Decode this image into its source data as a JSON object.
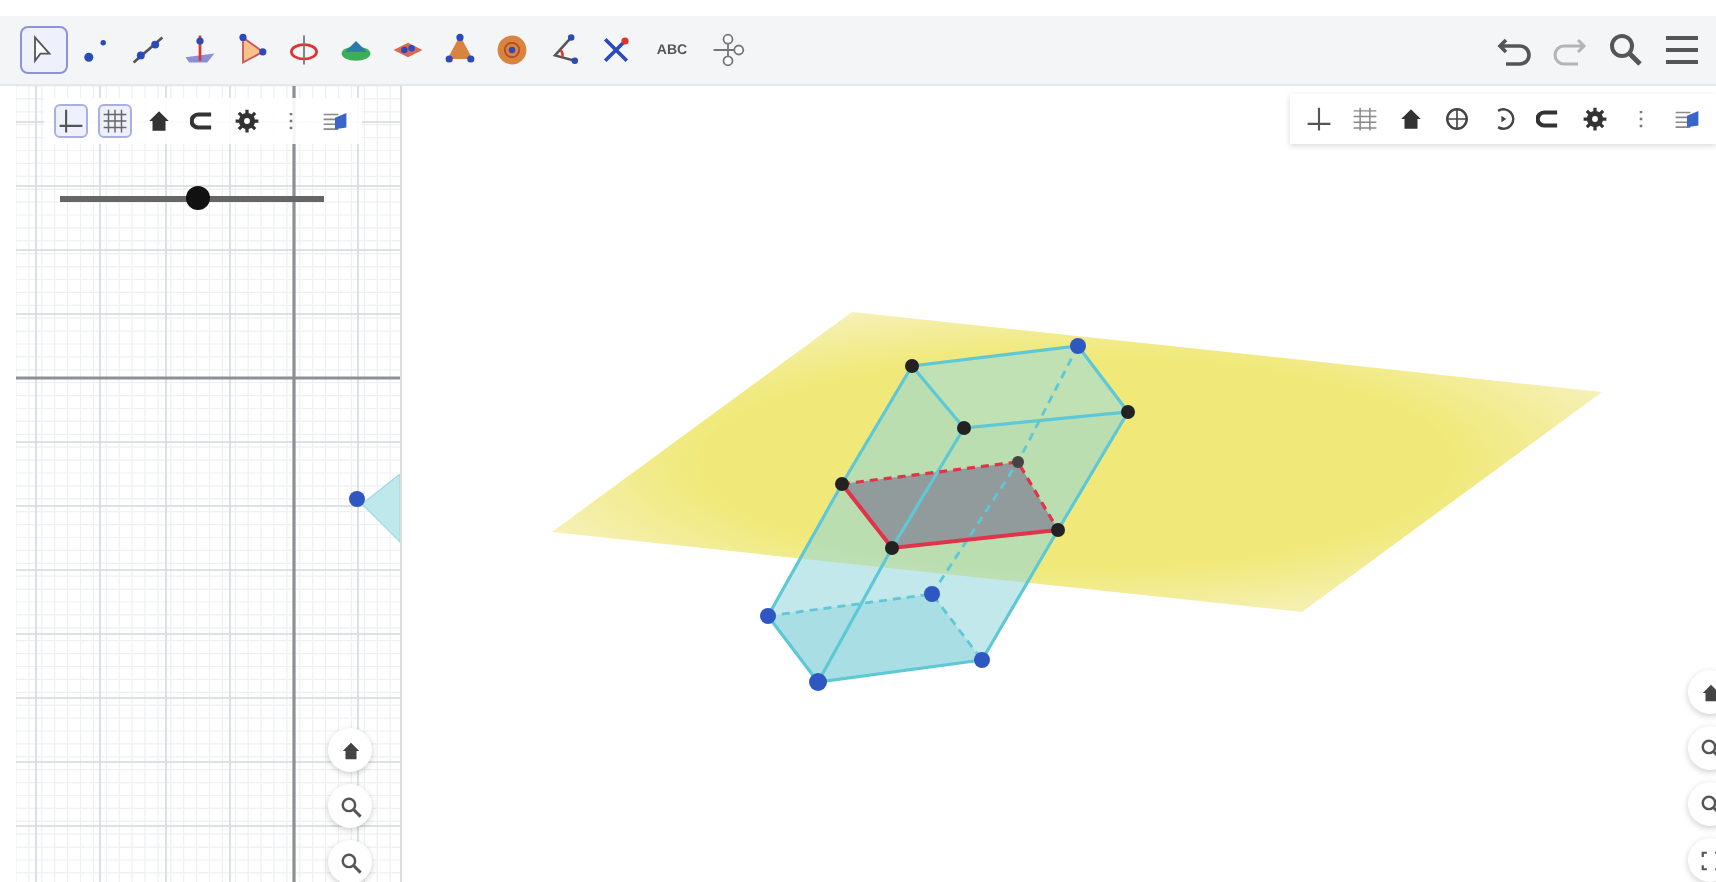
{
  "toolbar": {
    "tools": [
      {
        "kind": "move",
        "selected": true
      },
      {
        "kind": "point",
        "selected": false
      },
      {
        "kind": "line",
        "selected": false
      },
      {
        "kind": "perpendicular",
        "selected": false
      },
      {
        "kind": "polygon",
        "selected": false
      },
      {
        "kind": "circle",
        "selected": false
      },
      {
        "kind": "solid",
        "selected": false
      },
      {
        "kind": "plane",
        "selected": false
      },
      {
        "kind": "pyramid",
        "selected": false
      },
      {
        "kind": "sphere",
        "selected": false
      },
      {
        "kind": "angle",
        "selected": false
      },
      {
        "kind": "reflect",
        "selected": false
      },
      {
        "kind": "text",
        "label": "ABC",
        "selected": false
      },
      {
        "kind": "transform",
        "selected": false
      }
    ],
    "actions": [
      {
        "kind": "undo",
        "disabled": false
      },
      {
        "kind": "redo",
        "disabled": true
      },
      {
        "kind": "search",
        "disabled": false
      },
      {
        "kind": "menu",
        "disabled": false
      }
    ]
  },
  "graphics": {
    "style_bar": [
      {
        "kind": "axes",
        "on": true
      },
      {
        "kind": "grid",
        "on": true
      },
      {
        "kind": "home",
        "on": false
      },
      {
        "kind": "copy",
        "on": false
      },
      {
        "kind": "gear",
        "on": false
      },
      {
        "kind": "more",
        "on": false
      },
      {
        "kind": "views",
        "on": false
      }
    ],
    "slider": {
      "level": 0.52
    },
    "buttons": [
      {
        "kind": "home"
      },
      {
        "kind": "zoom"
      },
      {
        "kind": "zoom"
      }
    ]
  },
  "view3d": {
    "style_bar": [
      {
        "kind": "axes",
        "on": false
      },
      {
        "kind": "grid",
        "on": false
      },
      {
        "kind": "home",
        "on": false
      },
      {
        "kind": "cube",
        "on": false
      },
      {
        "kind": "rotate",
        "on": false
      },
      {
        "kind": "copy",
        "on": false
      },
      {
        "kind": "gear",
        "on": false
      },
      {
        "kind": "more",
        "on": false
      },
      {
        "kind": "views",
        "on": false
      }
    ],
    "buttons": [
      {
        "kind": "home"
      },
      {
        "kind": "zoom"
      },
      {
        "kind": "zoom"
      },
      {
        "kind": "fullscreen"
      }
    ]
  }
}
